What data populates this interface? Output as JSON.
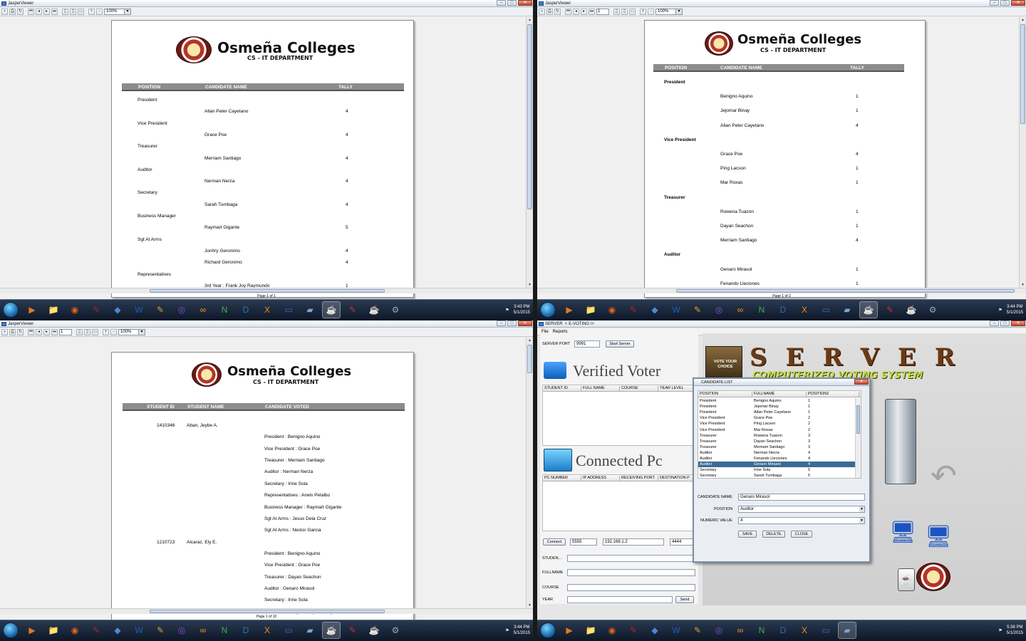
{
  "viewer_title": "JasperViewer",
  "server_title": "SERVER",
  "server_tab": "< E-VOTING />",
  "zoom": "100%",
  "page_field": "1",
  "school": {
    "name": "Osmeña Colleges",
    "dept": "CS - IT  DEPARTMENT"
  },
  "q1": {
    "headers": [
      "POSITION",
      "CANDIDATE NAME",
      "TALLY"
    ],
    "rows": [
      {
        "pos": "President"
      },
      {
        "name": "Allan Peter Cayetano",
        "tally": "4"
      },
      {
        "pos": "Vice President"
      },
      {
        "name": "Grace Poe",
        "tally": "4"
      },
      {
        "pos": "Treasurer"
      },
      {
        "name": "Merriam Santiago",
        "tally": "4"
      },
      {
        "pos": "Auditor"
      },
      {
        "name": "Nerman Nerza",
        "tally": "4"
      },
      {
        "pos": "Secretary"
      },
      {
        "name": "Sarah Tumbaga",
        "tally": "4"
      },
      {
        "pos": "Business Manager"
      },
      {
        "name": "Raymart Gigante",
        "tally": "5"
      },
      {
        "pos": "Sgt At Arms"
      },
      {
        "name": "Jonhry Geronimo",
        "tally": "4"
      },
      {
        "name": "Richard Geronimo",
        "tally": "4"
      },
      {
        "pos": "Representatives"
      },
      {
        "name": "3rd Year : Frank Joy Raymundo",
        "tally": "1"
      }
    ],
    "status": "Page 1 of 1"
  },
  "q2": {
    "headers": [
      "POSITION",
      "CANDIDATE NAME",
      "TALLY"
    ],
    "rows": [
      {
        "pos": "President"
      },
      {
        "name": "Benigno Aquino",
        "tally": "1"
      },
      {
        "name": "Jejomar Binay",
        "tally": "1"
      },
      {
        "name": "Allan Peter Cayetano",
        "tally": "4"
      },
      {
        "pos": "Vice President"
      },
      {
        "name": "Grace Poe",
        "tally": "4"
      },
      {
        "name": "Ping Lacson",
        "tally": "1"
      },
      {
        "name": "Mar Roxas",
        "tally": "1"
      },
      {
        "pos": "Treasurer"
      },
      {
        "name": "Rowena Tuazon",
        "tally": "1"
      },
      {
        "name": "Dayan Seachon",
        "tally": "1"
      },
      {
        "name": "Merriam Santiago",
        "tally": "4"
      },
      {
        "pos": "Auditor"
      },
      {
        "name": "Genaro Mirasol",
        "tally": "1"
      },
      {
        "name": "Fenando Lleciones",
        "tally": "1"
      }
    ],
    "status": "Page 1 of 2"
  },
  "q3": {
    "headers": [
      "STUDENT ID",
      "STUDENT NAME",
      "CANDIDATE VOTED"
    ],
    "students": [
      {
        "id": "1410346",
        "name": "Aban, Jeybe A.",
        "votes": [
          "President : Benigno Aquino",
          "Vice President : Grace Poe",
          "Treasurer : Merriam Santiago",
          "Auditor : Nerman Nerza",
          "Secretary : Irine Sola",
          "Representatives : Arwin Petalbo",
          "Business Manager : Raymart Gigante",
          "Sgt At Arms : Jesus Dela Cruz",
          "Sgt At Arms : Nestor Garcia"
        ]
      },
      {
        "id": "1210723",
        "name": "Alcaraz, Ely E.",
        "votes": [
          "President : Benigno Aquino",
          "Vice President : Grace Poe",
          "Treasurer : Dayan Seachon",
          "Auditor : Genaro Mirasol",
          "Secretary : Irine Sola",
          "Business Manager : Raymart Gigante",
          "Business Manager : Niño Jay Huelva"
        ]
      }
    ],
    "status": "Page 1 of 10"
  },
  "q4": {
    "menu": [
      "File",
      "Reports"
    ],
    "server_port_label": "SERVER PORT",
    "server_port": "9991",
    "start_server": "Start Server",
    "verified_voter": "Verified Voter",
    "voter_cols": [
      "STUDENT ID",
      "FULL NAME",
      "COURSE",
      "YEAR LEVEL"
    ],
    "connected_pc": "Connected Pc",
    "pc_cols": [
      "PC NUMBER",
      "IP ADDRESS",
      "RECEIVING PORT",
      "DESTINATION P"
    ],
    "connect": "Connect",
    "port1": "5555",
    "ip": "192.168.1.2",
    "port2": "4444",
    "form_labels": [
      "STUDEN...",
      "FULLNAME",
      "COURSE",
      "YEAR"
    ],
    "send": "Send",
    "banner": "SERVER",
    "banner_sub": "COMPUTERIZED VOTING SYSTEM",
    "ballot_text": "VOTE YOUR CHOICE",
    "dialog": {
      "title": "CANDIDATE LIST",
      "cols": [
        "POSITION",
        "FULLNAME",
        "POSITION2"
      ],
      "rows": [
        [
          "President",
          "Benigno Aquino",
          "1"
        ],
        [
          "President",
          "Jejomar Binay",
          "1"
        ],
        [
          "President",
          "Allan Peter Cayetano",
          "1"
        ],
        [
          "Vice President",
          "Grace Poe",
          "2"
        ],
        [
          "Vice President",
          "Ping Lacson",
          "2"
        ],
        [
          "Vice President",
          "Mar Roxas",
          "2"
        ],
        [
          "Treasurer",
          "Rowena Tuazon",
          "3"
        ],
        [
          "Treasurer",
          "Dayan Seachon",
          "3"
        ],
        [
          "Treasurer",
          "Merriam Santiago",
          "3"
        ],
        [
          "Auditor",
          "Nerman Nerza",
          "4"
        ],
        [
          "Auditor",
          "Fenando Lleciones",
          "4"
        ],
        [
          "Auditor",
          "Genaro Mirasol",
          "4"
        ],
        [
          "Secretary",
          "Irine Sola",
          "5"
        ],
        [
          "Secretary",
          "Sarah Tumbaga",
          "5"
        ]
      ],
      "selected_row": 11,
      "candidate_label": "CANDIDATE NAME",
      "candidate_value": "Genaro Mirasol",
      "position_label": "POSITION",
      "position_value": "Auditor",
      "numeric_label": "NUMERIC VALUE",
      "numeric_value": "4",
      "save": "SAVE",
      "delete": "DELETE",
      "close": "CLOSE"
    }
  },
  "clocks": [
    {
      "time": "3:43 PM",
      "date": "5/1/2015"
    },
    {
      "time": "3:44 PM",
      "date": "5/1/2015"
    },
    {
      "time": "3:44 PM",
      "date": "5/1/2015"
    },
    {
      "time": "5:38 PM",
      "date": "5/1/2015"
    }
  ],
  "taskbar_icons": [
    "media-player-icon",
    "explorer-icon",
    "firefox-icon",
    "acrobat-icon",
    "virtualbox-icon",
    "word-icon",
    "paint-icon",
    "eclipse-icon",
    "java-icon",
    "notepadpp-icon",
    "devcpp-icon",
    "xampp-icon",
    "monitor-icon",
    "virtual-pc-icon",
    "netbeans-icon",
    "filezilla-icon",
    "java-running-icon",
    "network-icon"
  ]
}
